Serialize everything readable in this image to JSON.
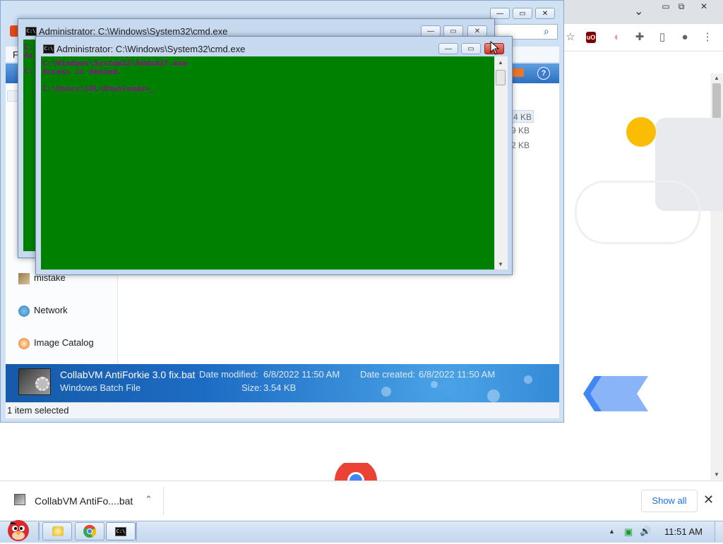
{
  "chrome": {
    "window_buttons": [
      "▭",
      "⧉",
      "✕"
    ],
    "toolbar_icons": {
      "bookmark": "☆",
      "ublock": "uO",
      "translate": "◐",
      "extensions": "✚",
      "sidepanel": "▯",
      "profile": "●",
      "menu": "⋮"
    },
    "tab_chevron": "⌄",
    "download_bar": {
      "file_name": "CollabVM AntiFo....bat",
      "show_all": "Show all",
      "close": "✕",
      "chevron": "⌃"
    },
    "colors": {
      "yellow": "#fbbc04",
      "blue": "#4285f4",
      "lightblue": "#8ab4f8"
    }
  },
  "explorer": {
    "menu_letter": "F",
    "search_icon": "⌕",
    "help_icon": "?",
    "sizes": [
      "4 KB",
      "9 KB",
      "2 KB"
    ],
    "nav": [
      {
        "label": "mistake",
        "icon": "folder-icon"
      },
      {
        "label": "Network",
        "icon": "network-icon"
      },
      {
        "label": "Image Catalog",
        "icon": "image-catalog-icon"
      }
    ],
    "details": {
      "file_name": "CollabVM AntiForkie 3.0 fix.bat",
      "file_type": "Windows Batch File",
      "date_modified_label": "Date modified:",
      "date_modified": "6/8/2022 11:50 AM",
      "date_created_label": "Date created:",
      "date_created": "6/8/2022 11:50 AM",
      "size_label": "Size:",
      "size": "3.54 KB"
    },
    "status": "1 item selected"
  },
  "cmd_back": {
    "title": "Administrator: C:\\Windows\\System32\\cmd.exe",
    "console_peek": [
      "C:",
      "Ac",
      "C:"
    ]
  },
  "cmd_front": {
    "title": "Administrator: C:\\Windows\\System32\\cmd.exe",
    "buttons": {
      "minimize": "—",
      "maximize": "▭",
      "close": "✕"
    },
    "console_lines": [
      "C:\\Windows\\System32\\hedsdif.exe",
      "Access is denied.",
      "",
      "C:\\Users\\LOL\\Downloads>_"
    ],
    "console_bg": "#008000",
    "console_fg": "#8b0e8b"
  },
  "taskbar": {
    "clock": "11:51 AM",
    "tray": {
      "up": "▲",
      "network": "▣",
      "volume": "🔊"
    }
  }
}
